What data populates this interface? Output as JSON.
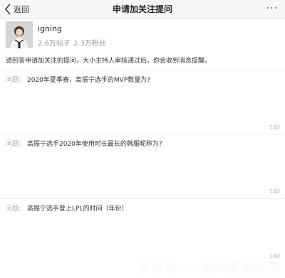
{
  "nav": {
    "back_label": "返回",
    "title": "申请加关注提问",
    "more_label": "···"
  },
  "profile": {
    "username": "igning",
    "posts": "2.6万帖子",
    "followers": "2.3万粉丝"
  },
  "notice": "请回答申请加关注的提问，大小主持人审核通过后，你会收到消息提醒。",
  "questions": [
    {
      "label": "问题:",
      "text": "2020年夏季赛，高振宁选手的MVP数量为?",
      "count": "140"
    },
    {
      "label": "问题:",
      "text": "高振宁选手2020年使用时长最长的韩服昵称为?",
      "count": "140"
    },
    {
      "label": "问题:",
      "text": "高振宁选手登上LPL的时间（年份）",
      "count": "140"
    }
  ],
  "watermark": "头条号 / 一路向前的北风"
}
